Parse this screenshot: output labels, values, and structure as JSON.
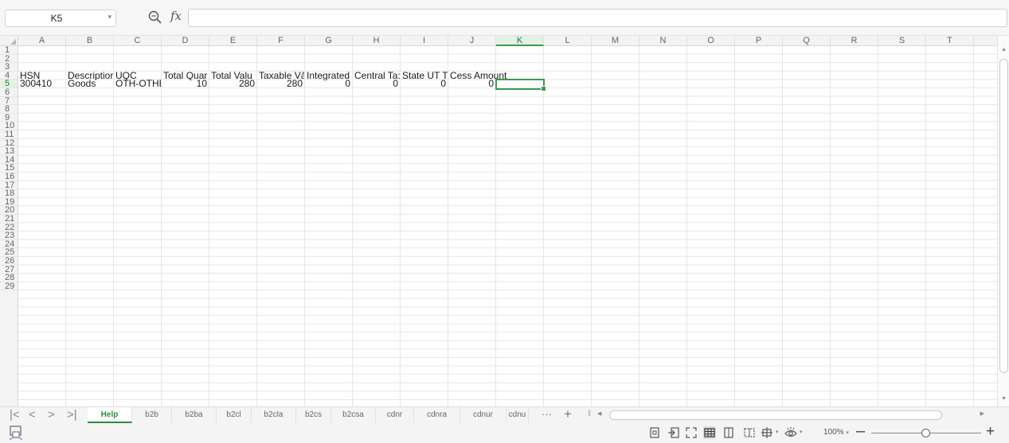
{
  "formula_bar": {
    "name_box": "K5",
    "fx_label": "fx",
    "formula_value": ""
  },
  "columns": [
    "A",
    "B",
    "C",
    "D",
    "E",
    "F",
    "G",
    "H",
    "I",
    "J",
    "K",
    "L",
    "M",
    "N",
    "O",
    "P",
    "Q",
    "R",
    "S",
    "T"
  ],
  "active_column": "K",
  "rows": [
    "1",
    "2",
    "3",
    "4",
    "5",
    "6",
    "7",
    "8",
    "9",
    "10",
    "11",
    "12",
    "13",
    "14",
    "15",
    "16",
    "17",
    "18",
    "19",
    "20",
    "21",
    "22",
    "23",
    "24",
    "25",
    "26",
    "27",
    "28",
    "29"
  ],
  "active_row": "5",
  "header_row": [
    "HSN",
    "Descriptior",
    "UQC",
    "Total Quar",
    "Total Valu",
    "Taxable Vå",
    "Integrated",
    "Central Ta:",
    "State UT T",
    "Cess Amount"
  ],
  "data_row": [
    "300410",
    "Goods",
    "OTH-OTHE",
    "10",
    "280",
    "280",
    "0",
    "0",
    "0",
    "0"
  ],
  "sheet_nav": [
    "|<",
    "<",
    ">",
    ">|"
  ],
  "sheets": [
    "Help",
    "b2b",
    "b2ba",
    "b2cl",
    "b2cla",
    "b2cs",
    "b2csa",
    "cdnr",
    "cdnra",
    "cdnur",
    "cdnu"
  ],
  "active_sheet": "Help",
  "tab_more": "···",
  "tab_add": "+",
  "status": {
    "zoom": "100%",
    "zoom_level_fraction": 0.5,
    "icons": [
      "macro-icon",
      "page-icon",
      "export-icon",
      "fullscreen-icon",
      "normal-view-icon",
      "page-layout-icon",
      "page-break-icon",
      "freeze-panes-icon",
      "eye-protection-icon"
    ],
    "active_view": "normal-view-icon"
  },
  "colors": {
    "accent": "#3d9a4f",
    "header_bg": "#f3f3f3",
    "gridline": "#e6e6e6"
  }
}
